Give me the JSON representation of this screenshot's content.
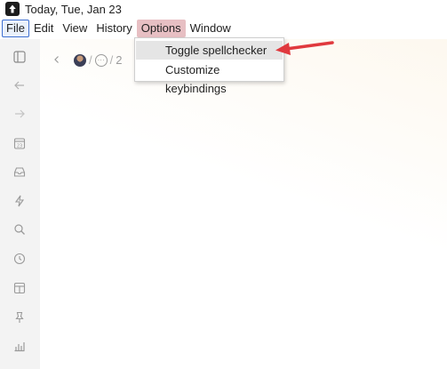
{
  "window": {
    "title": "Today, Tue, Jan 23",
    "logo_icon": "arrow-up-logo-icon"
  },
  "menubar": {
    "items": [
      "File",
      "Edit",
      "View",
      "History",
      "Options",
      "Window"
    ]
  },
  "options_menu": {
    "items": [
      "Toggle spellchecker",
      "Customize keybindings"
    ],
    "highlighted_index": 0
  },
  "sidebar": {
    "icons": [
      "panel-toggle-icon",
      "back-arrow-icon",
      "forward-arrow-icon",
      "calendar-icon",
      "inbox-icon",
      "lightning-icon",
      "search-icon",
      "clock-icon",
      "layout-icon",
      "pin-icon",
      "chart-icon"
    ]
  },
  "breadcrumb": {
    "separator": "/",
    "more_label": "···",
    "tail": "2"
  },
  "annotation": {
    "color": "#e0393e"
  },
  "colors": {
    "options_highlight": "#e7bfc3",
    "file_focus_border": "#3d6fd1",
    "rail_bg": "#f3f3f3"
  }
}
